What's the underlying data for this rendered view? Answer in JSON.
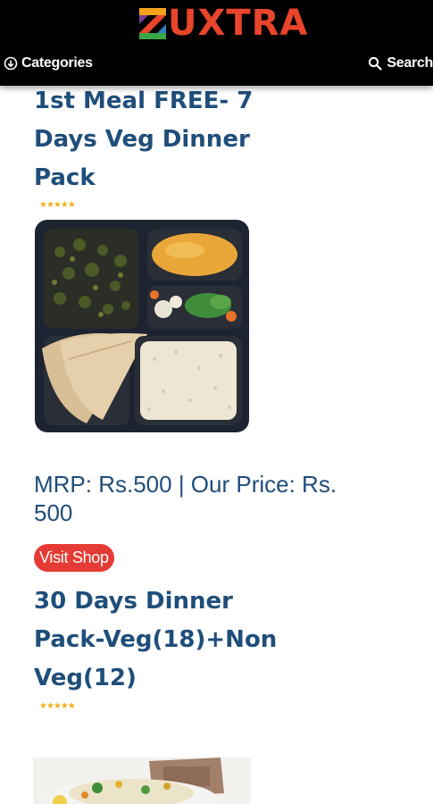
{
  "header": {
    "brand_text": "UXTRA",
    "brand_letter": "Z",
    "categories_label": "Categories",
    "search_label": "Search",
    "icons": [
      "chevron-circle-down-icon",
      "search-icon"
    ]
  },
  "products": [
    {
      "title_lines": [
        "1st Meal FREE- 7",
        "Days Veg Dinner",
        "Pack"
      ],
      "rating_stars": "★★★★★",
      "price_lines": [
        "MRP: Rs.500 | Our Price: Rs.",
        "500"
      ],
      "visit_label": "Visit Shop"
    },
    {
      "title_lines": [
        "30 Days Dinner",
        "Pack-Veg(18)+Non",
        "Veg(12)"
      ],
      "rating_stars": "★★★★★"
    }
  ],
  "colors": {
    "header_bg": "#000000",
    "brand": "#e8452c",
    "title": "#1f4e7a",
    "button": "#e63b34",
    "stars": "#f2b01e"
  }
}
